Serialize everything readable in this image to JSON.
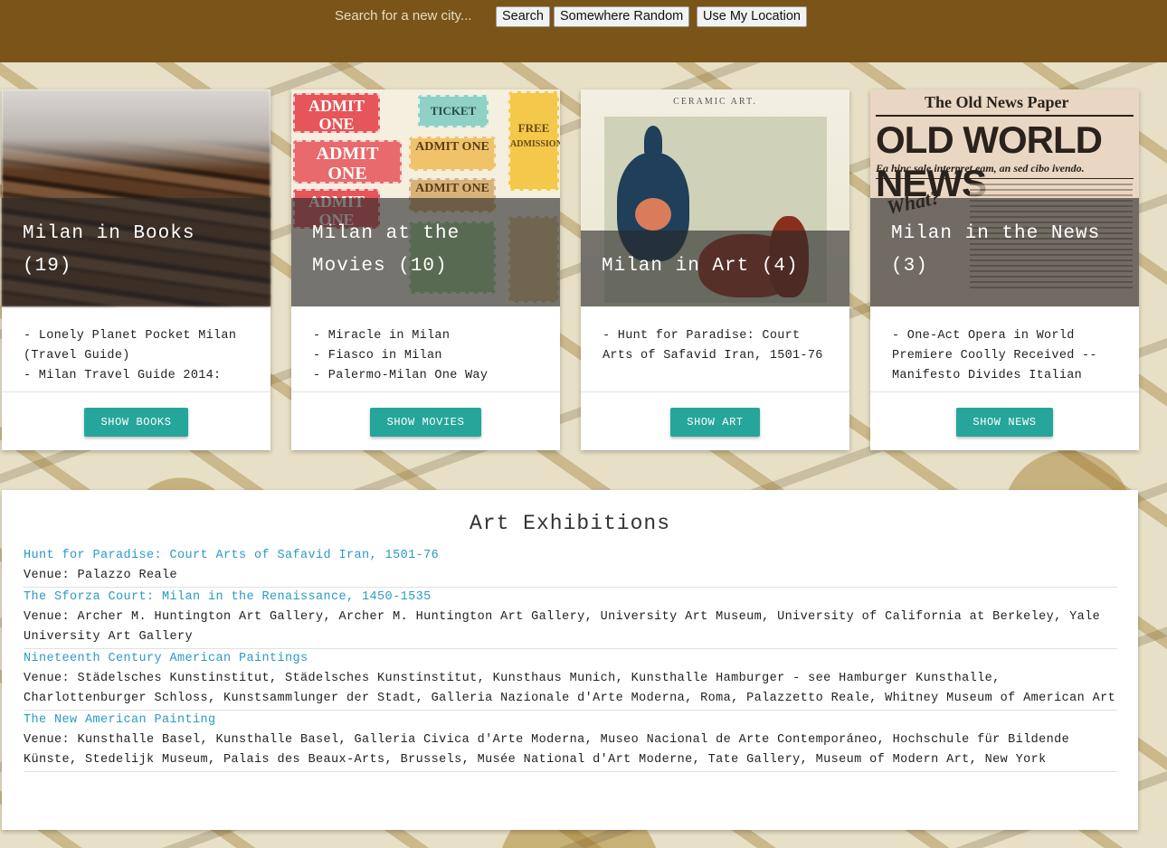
{
  "topbar": {
    "search_placeholder": "Search for a new city...",
    "search_label": "Search",
    "random_label": "Somewhere Random",
    "location_label": "Use My Location"
  },
  "cards": [
    {
      "title": "Milan in Books (19)",
      "items": [
        "- Lonely Planet Pocket Milan (Travel Guide)",
        "- Milan Travel Guide 2014:"
      ],
      "button": "SHOW BOOKS"
    },
    {
      "title": "Milan at the Movies (10)",
      "items": [
        "- Miracle in Milan",
        "- Fiasco in Milan",
        "- Palermo-Milan One Way"
      ],
      "button": "SHOW MOVIES"
    },
    {
      "title": "Milan in Art (4)",
      "items": [
        "- Hunt for Paradise: Court Arts of Safavid Iran, 1501-76"
      ],
      "button": "SHOW ART"
    },
    {
      "title": "Milan in the News (3)",
      "items": [
        "- One-Act Opera in World Premiere Coolly Received -- Manifesto Divides Italian"
      ],
      "button": "SHOW NEWS"
    }
  ],
  "movie_tickets": {
    "admit_one": "ADMIT ONE",
    "ticket": "TICKET",
    "free": "FREE",
    "admission": "ADMISSION"
  },
  "art_image": {
    "caption": "CERAMIC ART."
  },
  "news_image": {
    "masthead": "The Old News Paper",
    "headline": "OLD WORLD NEWS",
    "subhead": "Ea hinc sale interpret eam, an sed cibo ivendo.",
    "what": "What?"
  },
  "exhibitions": {
    "title": "Art Exhibitions",
    "items": [
      {
        "name": "Hunt for Paradise: Court Arts of Safavid Iran, 1501-76",
        "venue": "Venue: Palazzo Reale"
      },
      {
        "name": "The Sforza Court: Milan in the Renaissance, 1450-1535",
        "venue": "Venue: Archer M. Huntington Art Gallery, Archer M. Huntington Art Gallery, University Art Museum, University of California at Berkeley, Yale University Art Gallery"
      },
      {
        "name": "Nineteenth Century American Paintings",
        "venue": "Venue: Städelsches Kunstinstitut, Städelsches Kunstinstitut, Kunsthaus Munich, Kunsthalle Hamburger - see Hamburger Kunsthalle, Charlottenburger Schloss, Kunstsammlunger der Stadt, Galleria Nazionale d'Arte Moderna, Roma, Palazzetto Reale, Whitney Museum of American Art"
      },
      {
        "name": "The New American Painting",
        "venue": "Venue: Kunsthalle Basel, Kunsthalle Basel, Galleria Civica d'Arte Moderna, Museo Nacional de Arte Contemporáneo, Hochschule für Bildende Künste, Stedelijk Museum, Palais des Beaux-Arts, Brussels, Musée National d'Art Moderne, Tate Gallery, Museum of Modern Art, New York"
      }
    ]
  }
}
